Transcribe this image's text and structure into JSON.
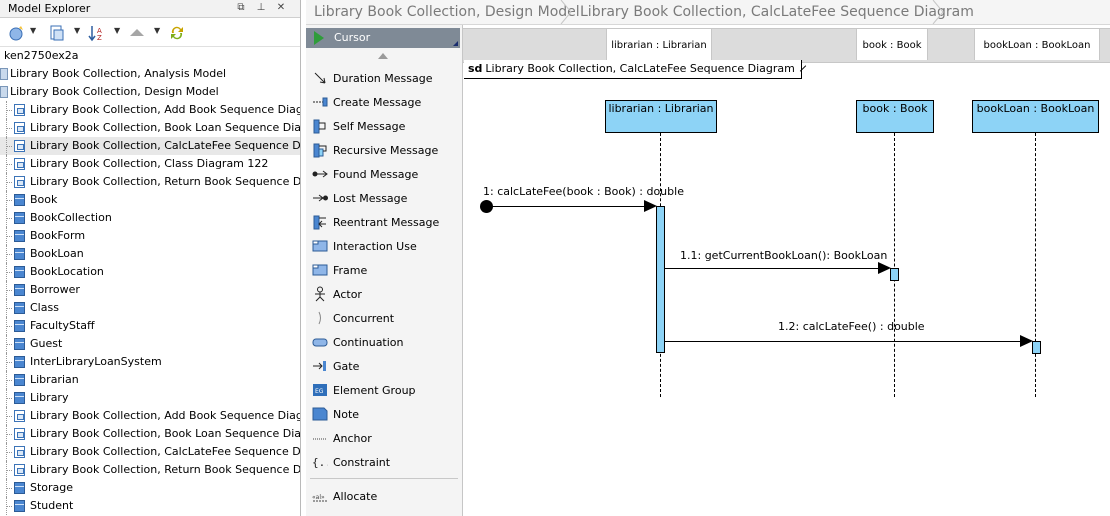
{
  "explorer": {
    "title": "Model Explorer",
    "controls": [
      "⧉",
      "⊥",
      "✕"
    ],
    "items": [
      {
        "label": "ken2750ex2a",
        "icon": "none",
        "indent": 0
      },
      {
        "label": "Library Book Collection, Analysis Model",
        "icon": "model-icon",
        "indent": 1
      },
      {
        "label": "Library Book Collection, Design Model",
        "icon": "model-icon",
        "indent": 1
      },
      {
        "label": "Library Book Collection, Add Book Sequence Diagram",
        "icon": "diagram-icon",
        "indent": 2
      },
      {
        "label": "Library Book Collection, Book Loan Sequence Diagram",
        "icon": "diagram-icon",
        "indent": 2
      },
      {
        "label": "Library Book Collection, CalcLateFee Sequence Diagram",
        "icon": "diagram-icon",
        "indent": 2,
        "selected": true
      },
      {
        "label": "Library Book Collection, Class Diagram 122",
        "icon": "diagram-icon",
        "indent": 2
      },
      {
        "label": "Library Book Collection, Return Book Sequence Diagram",
        "icon": "diagram-icon",
        "indent": 2
      },
      {
        "label": "Book",
        "icon": "class-icon",
        "indent": 2
      },
      {
        "label": "BookCollection",
        "icon": "class-icon",
        "indent": 2
      },
      {
        "label": "BookForm",
        "icon": "class-icon",
        "indent": 2
      },
      {
        "label": "BookLoan",
        "icon": "class-icon",
        "indent": 2
      },
      {
        "label": "BookLocation",
        "icon": "class-icon",
        "indent": 2
      },
      {
        "label": "Borrower",
        "icon": "class-icon",
        "indent": 2
      },
      {
        "label": "Class",
        "icon": "class-icon",
        "indent": 2
      },
      {
        "label": "FacultyStaff",
        "icon": "class-icon",
        "indent": 2
      },
      {
        "label": "Guest",
        "icon": "class-icon",
        "indent": 2
      },
      {
        "label": "InterLibraryLoanSystem",
        "icon": "class-icon",
        "indent": 2
      },
      {
        "label": "Librarian",
        "icon": "class-icon",
        "indent": 2
      },
      {
        "label": "Library",
        "icon": "class-icon",
        "indent": 2
      },
      {
        "label": "Library Book Collection, Add Book Sequence Diagram",
        "icon": "diagram-icon",
        "indent": 2
      },
      {
        "label": "Library Book Collection, Book Loan Sequence Diagram",
        "icon": "diagram-icon",
        "indent": 2
      },
      {
        "label": "Library Book Collection, CalcLateFee Sequence Diagram",
        "icon": "diagram-icon",
        "indent": 2
      },
      {
        "label": "Library Book Collection, Return Book Sequence Diagram",
        "icon": "diagram-icon",
        "indent": 2
      },
      {
        "label": "Storage",
        "icon": "class-icon",
        "indent": 2
      },
      {
        "label": "Student",
        "icon": "class-icon",
        "indent": 2
      }
    ]
  },
  "breadcrumb": [
    "Library Book Collection, Design Model",
    "Library Book Collection, CalcLateFee Sequence Diagram"
  ],
  "palette": {
    "cursor_label": "Cursor",
    "items": [
      {
        "label": "Duration Message",
        "icon": "duration-message-icon"
      },
      {
        "label": "Create Message",
        "icon": "create-message-icon"
      },
      {
        "label": "Self Message",
        "icon": "self-message-icon"
      },
      {
        "label": "Recursive Message",
        "icon": "recursive-message-icon"
      },
      {
        "label": "Found Message",
        "icon": "found-message-icon"
      },
      {
        "label": "Lost Message",
        "icon": "lost-message-icon"
      },
      {
        "label": "Reentrant Message",
        "icon": "reentrant-message-icon"
      },
      {
        "label": "Interaction Use",
        "icon": "interaction-use-icon"
      },
      {
        "label": "Frame",
        "icon": "frame-icon"
      },
      {
        "label": "Actor",
        "icon": "actor-icon"
      },
      {
        "label": "Concurrent",
        "icon": "concurrent-icon"
      },
      {
        "label": "Continuation",
        "icon": "continuation-icon"
      },
      {
        "label": "Gate",
        "icon": "gate-icon"
      },
      {
        "label": "Element Group",
        "icon": "element-group-icon"
      },
      {
        "label": "Note",
        "icon": "note-icon"
      },
      {
        "label": "Anchor",
        "icon": "anchor-icon"
      },
      {
        "label": "Constraint",
        "icon": "constraint-icon"
      },
      {
        "label": "Allocate",
        "icon": "allocate-icon"
      }
    ]
  },
  "diagram": {
    "frame_keyword": "sd",
    "frame_title": "Library Book Collection, CalcLateFee Sequence Diagram",
    "ruler_tabs": [
      "librarian : Librarian",
      "book : Book",
      "bookLoan : BookLoan"
    ],
    "lifelines": [
      {
        "label": "librarian : Librarian"
      },
      {
        "label": "book : Book"
      },
      {
        "label": "bookLoan : BookLoan"
      }
    ],
    "messages": [
      {
        "label": "1: calcLateFee(book : Book) : double"
      },
      {
        "label": "1.1: getCurrentBookLoan(): BookLoan"
      },
      {
        "label": "1.2: calcLateFee() : double"
      }
    ]
  }
}
